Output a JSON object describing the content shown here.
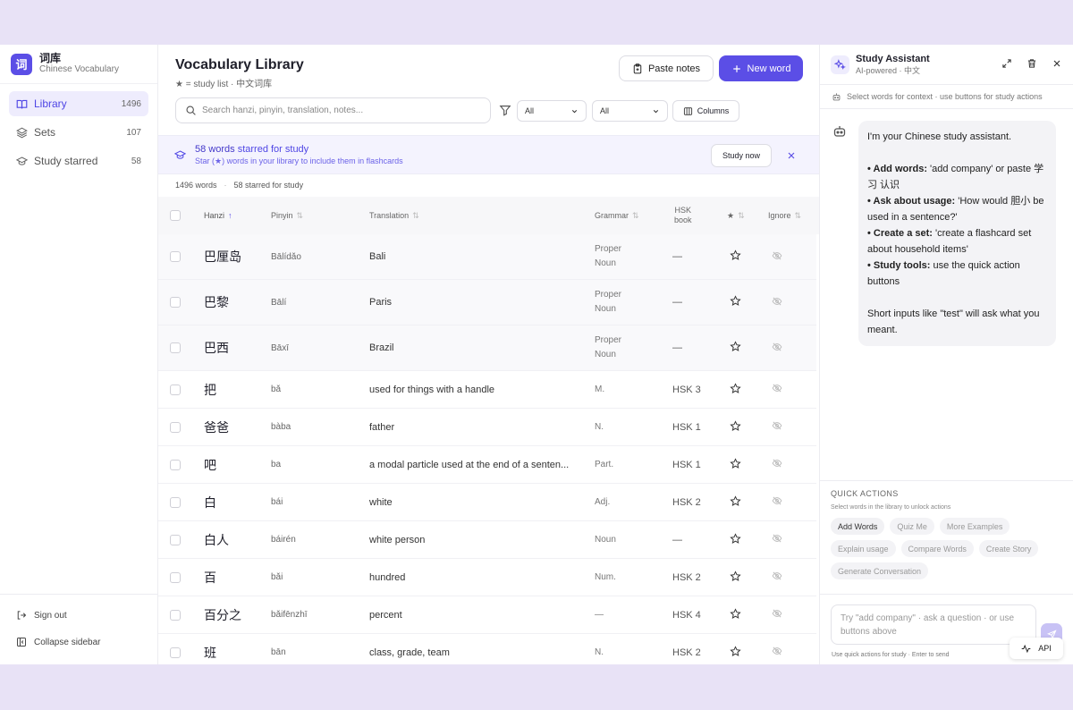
{
  "brand": {
    "logo": "词",
    "title": "词库",
    "subtitle": "Chinese Vocabulary"
  },
  "sidebar": {
    "items": [
      {
        "label": "Library",
        "count": "1496",
        "icon": "book-icon",
        "active": true
      },
      {
        "label": "Sets",
        "count": "107",
        "icon": "layers-icon",
        "active": false
      },
      {
        "label": "Study starred",
        "count": "58",
        "icon": "graduation-cap-icon",
        "active": false
      }
    ],
    "bottom": [
      {
        "label": "Sign out",
        "icon": "sign-out-icon"
      },
      {
        "label": "Collapse sidebar",
        "icon": "collapse-sidebar-icon"
      }
    ]
  },
  "header": {
    "title": "Vocabulary Library",
    "subtitle": "★ = study list · 中文词库",
    "paste_label": "Paste notes",
    "new_label": "New word"
  },
  "toolbar": {
    "search_placeholder": "Search hanzi, pinyin, translation, notes...",
    "filter1": "All",
    "filter2": "All",
    "columns_label": "Columns"
  },
  "banner": {
    "count": "58 words",
    "title_rest": " starred for study",
    "subtitle": "Star (★) words in your library to include them in flashcards",
    "study_label": "Study now"
  },
  "stats": {
    "words": "1496 words",
    "starred": "58 starred for study"
  },
  "table": {
    "columns": {
      "hanzi": "Hanzi",
      "pinyin": "Pinyin",
      "translation": "Translation",
      "grammar": "Grammar",
      "hsk1": "HSK",
      "hsk2": "book",
      "star": "★",
      "ignore": "Ignore"
    },
    "rows": [
      {
        "hanzi": "巴厘岛",
        "pinyin": "Bālídǎo",
        "translation": "Bali",
        "grammar": [
          "Proper",
          "Noun"
        ],
        "hsk": "—"
      },
      {
        "hanzi": "巴黎",
        "pinyin": "Bālí",
        "translation": "Paris",
        "grammar": [
          "Proper",
          "Noun"
        ],
        "hsk": "—"
      },
      {
        "hanzi": "巴西",
        "pinyin": "Bāxī",
        "translation": "Brazil",
        "grammar": [
          "Proper",
          "Noun"
        ],
        "hsk": "—"
      },
      {
        "hanzi": "把",
        "pinyin": "bǎ",
        "translation": "used for things with a handle",
        "grammar": [
          "M."
        ],
        "hsk": "HSK 3"
      },
      {
        "hanzi": "爸爸",
        "pinyin": "bàba",
        "translation": "father",
        "grammar": [
          "N."
        ],
        "hsk": "HSK 1"
      },
      {
        "hanzi": "吧",
        "pinyin": "ba",
        "translation": "a modal particle used at the end of a senten...",
        "grammar": [
          "Part."
        ],
        "hsk": "HSK 1"
      },
      {
        "hanzi": "白",
        "pinyin": "bái",
        "translation": "white",
        "grammar": [
          "Adj."
        ],
        "hsk": "HSK 2"
      },
      {
        "hanzi": "白人",
        "pinyin": "báirén",
        "translation": "white person",
        "grammar": [
          "Noun"
        ],
        "hsk": "—"
      },
      {
        "hanzi": "百",
        "pinyin": "bǎi",
        "translation": "hundred",
        "grammar": [
          "Num."
        ],
        "hsk": "HSK 2"
      },
      {
        "hanzi": "百分之",
        "pinyin": "bǎifēnzhī",
        "translation": "percent",
        "grammar": [
          "—"
        ],
        "hsk": "HSK 4"
      },
      {
        "hanzi": "班",
        "pinyin": "bān",
        "translation": "class, grade, team",
        "grammar": [
          "N."
        ],
        "hsk": "HSK 2"
      }
    ]
  },
  "panel": {
    "title": "Study Assistant",
    "subtitle": "AI-powered · 中文",
    "context": "Select words for context · use buttons for study actions",
    "message": {
      "intro": "I'm your Chinese study assistant.",
      "b1_label": "• Add words:",
      "b1_text": " 'add company' or paste 学习 认识",
      "b2_label": "• Ask about usage:",
      "b2_text": " 'How would 胆小 be used in a sentence?'",
      "b3_label": "• Create a set:",
      "b3_text": " 'create a flashcard set about household items'",
      "b4_label": "• Study tools:",
      "b4_text": " use the quick action buttons",
      "outro": "Short inputs like \"test\" will ask what you meant."
    },
    "quick_title": "QUICK ACTIONS",
    "quick_sub": "Select words in the library to unlock actions",
    "chips": [
      "Add Words",
      "Quiz Me",
      "More Examples",
      "Explain usage",
      "Compare Words",
      "Create Story",
      "Generate Conversation"
    ],
    "input_placeholder": "Try \"add company\" · ask a question · or use buttons above",
    "hint": "Use quick actions for study · Enter to send",
    "api_label": "API"
  },
  "colors": {
    "accent": "#5b4ee6",
    "background": "#e8e2f6",
    "banner_bg": "#f4f3fe"
  }
}
